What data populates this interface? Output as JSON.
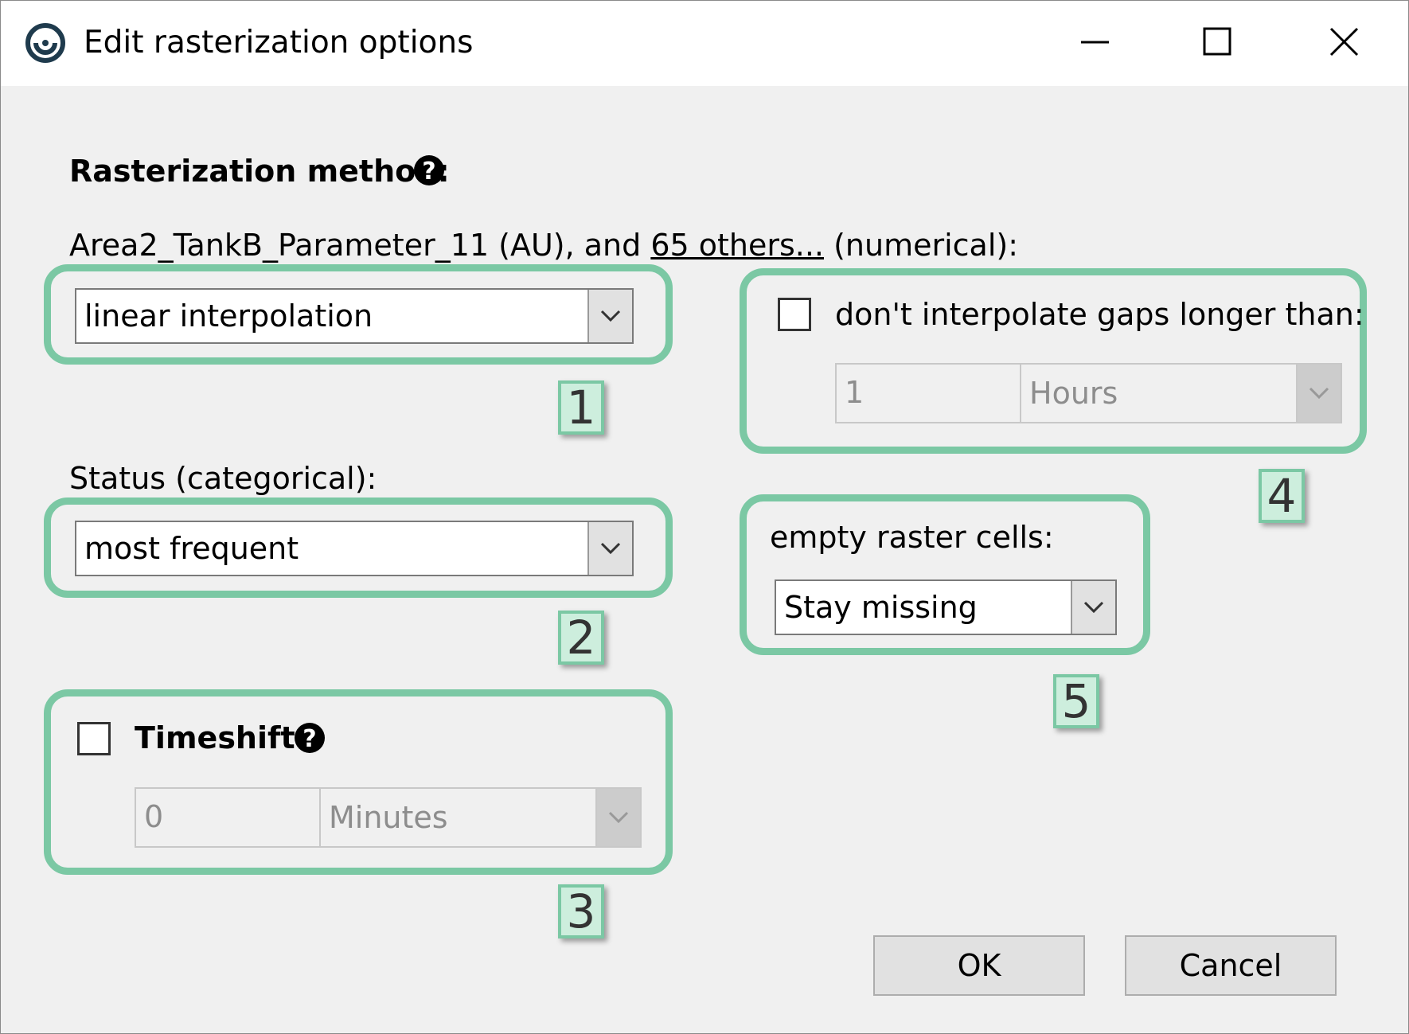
{
  "window": {
    "title": "Edit rasterization options",
    "controls": [
      "minimize",
      "maximize",
      "close"
    ]
  },
  "method": {
    "heading": "Rasterization method:",
    "numerical": {
      "label_prefix": "Area2_TankB_Parameter_11 (AU), and ",
      "label_link": "65 others...",
      "label_suffix": " (numerical):",
      "selected": "linear interpolation"
    },
    "categorical": {
      "label": "Status (categorical):",
      "selected": "most frequent"
    }
  },
  "timeshift": {
    "label": "Timeshift",
    "checked": false,
    "value": "0",
    "unit": "Minutes"
  },
  "gap": {
    "label": "don't interpolate gaps longer than:",
    "checked": false,
    "value": "1",
    "unit": "Hours"
  },
  "empty_cells": {
    "label": "empty raster cells:",
    "selected": "Stay missing"
  },
  "callouts": [
    "1",
    "2",
    "3",
    "4",
    "5"
  ],
  "buttons": {
    "ok": "OK",
    "cancel": "Cancel"
  },
  "colors": {
    "callout_border": "#7bc8a4",
    "callout_fill": "#cdeedd",
    "dialog_bg": "#f0f0f0"
  }
}
